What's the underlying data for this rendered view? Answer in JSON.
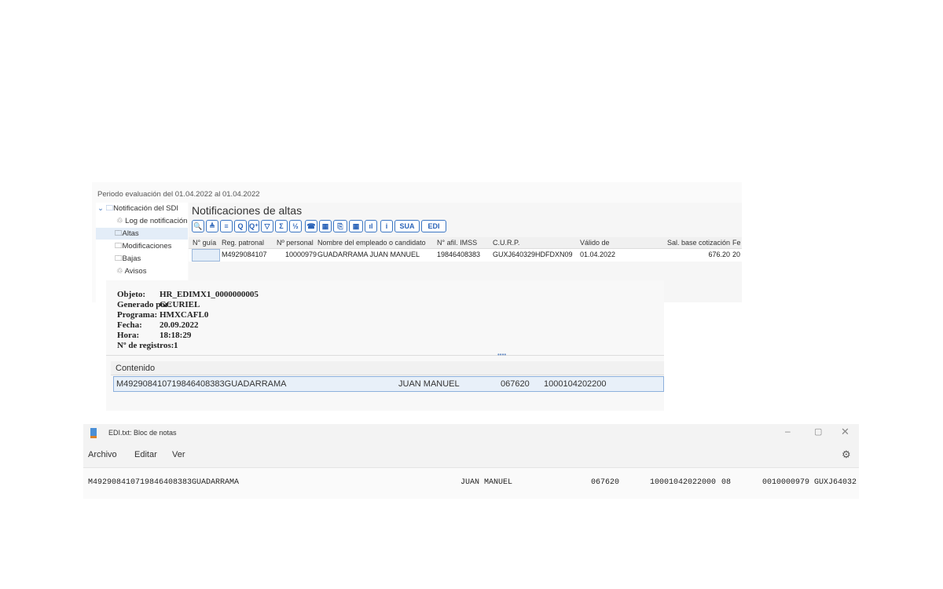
{
  "sap_report": {
    "period": "Periodo evaluación del 01.04.2022 al 01.04.2022",
    "tree": [
      {
        "label": "Notificación del SDI",
        "icon": "folder-open-icon"
      },
      {
        "label": "Log de notificación",
        "icon": "log-icon"
      },
      {
        "label": "Altas",
        "icon": "folder-icon"
      },
      {
        "label": "Modificaciones",
        "icon": "folder-icon"
      },
      {
        "label": "Bajas",
        "icon": "folder-icon"
      },
      {
        "label": "Avisos",
        "icon": "log-icon"
      }
    ],
    "title": "Notificaciones de altas",
    "toolbar": [
      "🔍",
      "≜",
      "≡",
      "Q",
      "Q⁺",
      "▽",
      "Σ",
      "½",
      "☎",
      "▦",
      "⎘",
      "▦",
      "ıl",
      "i",
      "SUA",
      "EDI"
    ],
    "columns": [
      "N° guía",
      "Reg. patronal",
      "Nº personal",
      "Nombre del empleado o candidato",
      "N° afil. IMSS",
      "C.U.R.P.",
      "Válido de",
      "Sal. base cotización",
      "Fe"
    ],
    "row": [
      "",
      "M4929084107",
      "10000979",
      "GUADARRAMA JUAN MANUEL",
      "19846408383",
      "GUXJ640329HDFDXN09",
      "01.04.2022",
      "676.20",
      "20"
    ]
  },
  "file_viewer": {
    "fields": [
      {
        "label": "Objeto:",
        "value": "HR_EDIMX1_0000000005"
      },
      {
        "label": "Generado por:",
        "value": "GCURIEL"
      },
      {
        "label": "Programa:",
        "value": "HMXCAFL0"
      },
      {
        "label": "Fecha:",
        "value": "20.09.2022"
      },
      {
        "label": "Hora:",
        "value": "18:18:29"
      },
      {
        "label": "Nº de registros:",
        "value": "1"
      }
    ],
    "content_header": "Contenido",
    "content_row": [
      "M492908410719846408383GUADARRAMA",
      "JUAN MANUEL",
      "067620",
      "1000104202200"
    ]
  },
  "notepad": {
    "title": "EDI.txt: Bloc de notas",
    "menu": [
      "Archivo",
      "Editar",
      "Ver"
    ],
    "line": [
      "M492908410719846408383GUADARRAMA",
      "JUAN MANUEL",
      "067620",
      "10001042022000",
      "08",
      "0010000979 GUXJ64032"
    ]
  }
}
